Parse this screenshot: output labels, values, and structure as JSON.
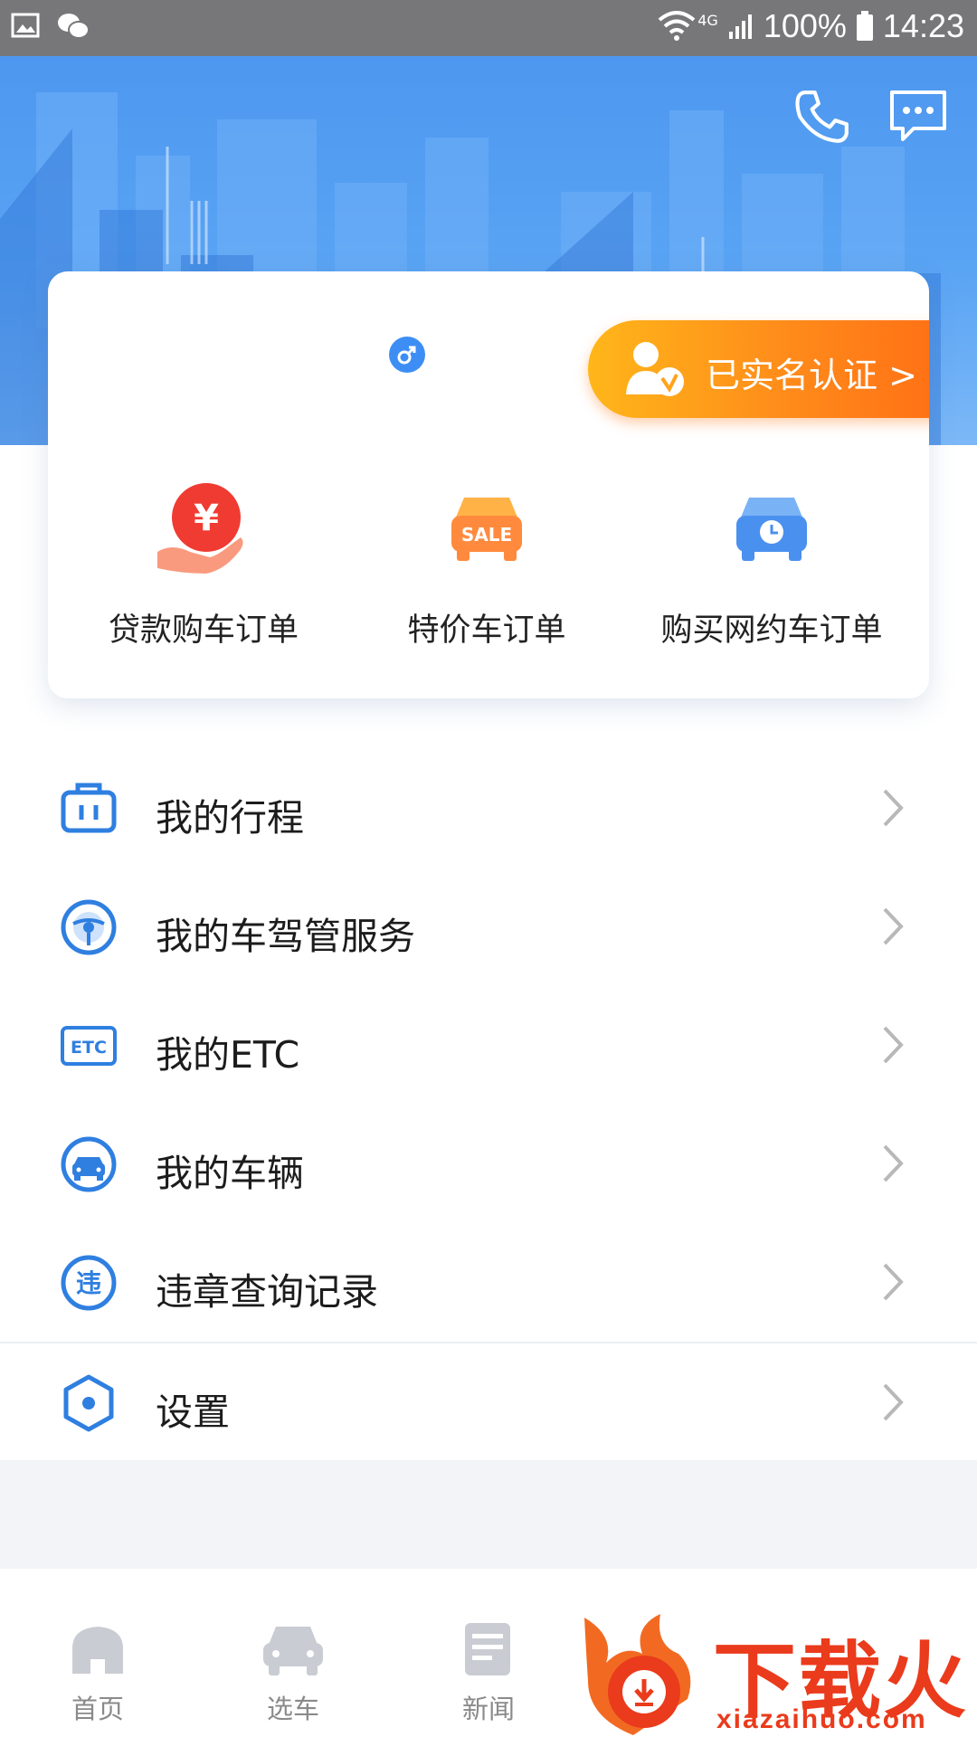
{
  "status_bar": {
    "network": "4G",
    "battery": "100%",
    "time": "14:23"
  },
  "header": {
    "phone_icon": "phone-icon",
    "message_icon": "chat-bubble-icon"
  },
  "profile": {
    "gender_icon": "male-icon",
    "verified_label": "已实名认证 >"
  },
  "orders": [
    {
      "label": "贷款购车订单",
      "icon": "loan-hand-yen-icon"
    },
    {
      "label": "特价车订单",
      "icon": "sale-car-icon"
    },
    {
      "label": "购买网约车订单",
      "icon": "ride-hailing-car-clock-icon"
    }
  ],
  "menu": [
    {
      "label": "我的行程",
      "icon": "trip-briefcase-icon"
    },
    {
      "label": "我的车驾管服务",
      "icon": "steering-wheel-icon"
    },
    {
      "label": "我的ETC",
      "icon": "etc-icon",
      "icon_text": "ETC"
    },
    {
      "label": "我的车辆",
      "icon": "car-icon"
    },
    {
      "label": "违章查询记录",
      "icon": "violation-icon",
      "icon_text": "违"
    },
    {
      "label": "设置",
      "icon": "settings-hexagon-icon"
    }
  ],
  "tabs": [
    {
      "label": "首页",
      "icon": "home-icon"
    },
    {
      "label": "选车",
      "icon": "car-icon"
    },
    {
      "label": "新闻",
      "icon": "news-icon"
    }
  ],
  "watermark": {
    "title": "下载火",
    "url": "xiazaihuo.com"
  },
  "colors": {
    "primary": "#3d8ef4",
    "icon_blue": "#2f7fe0",
    "verified_orange": "#ff7a18",
    "chevron": "#b8b8b8"
  }
}
